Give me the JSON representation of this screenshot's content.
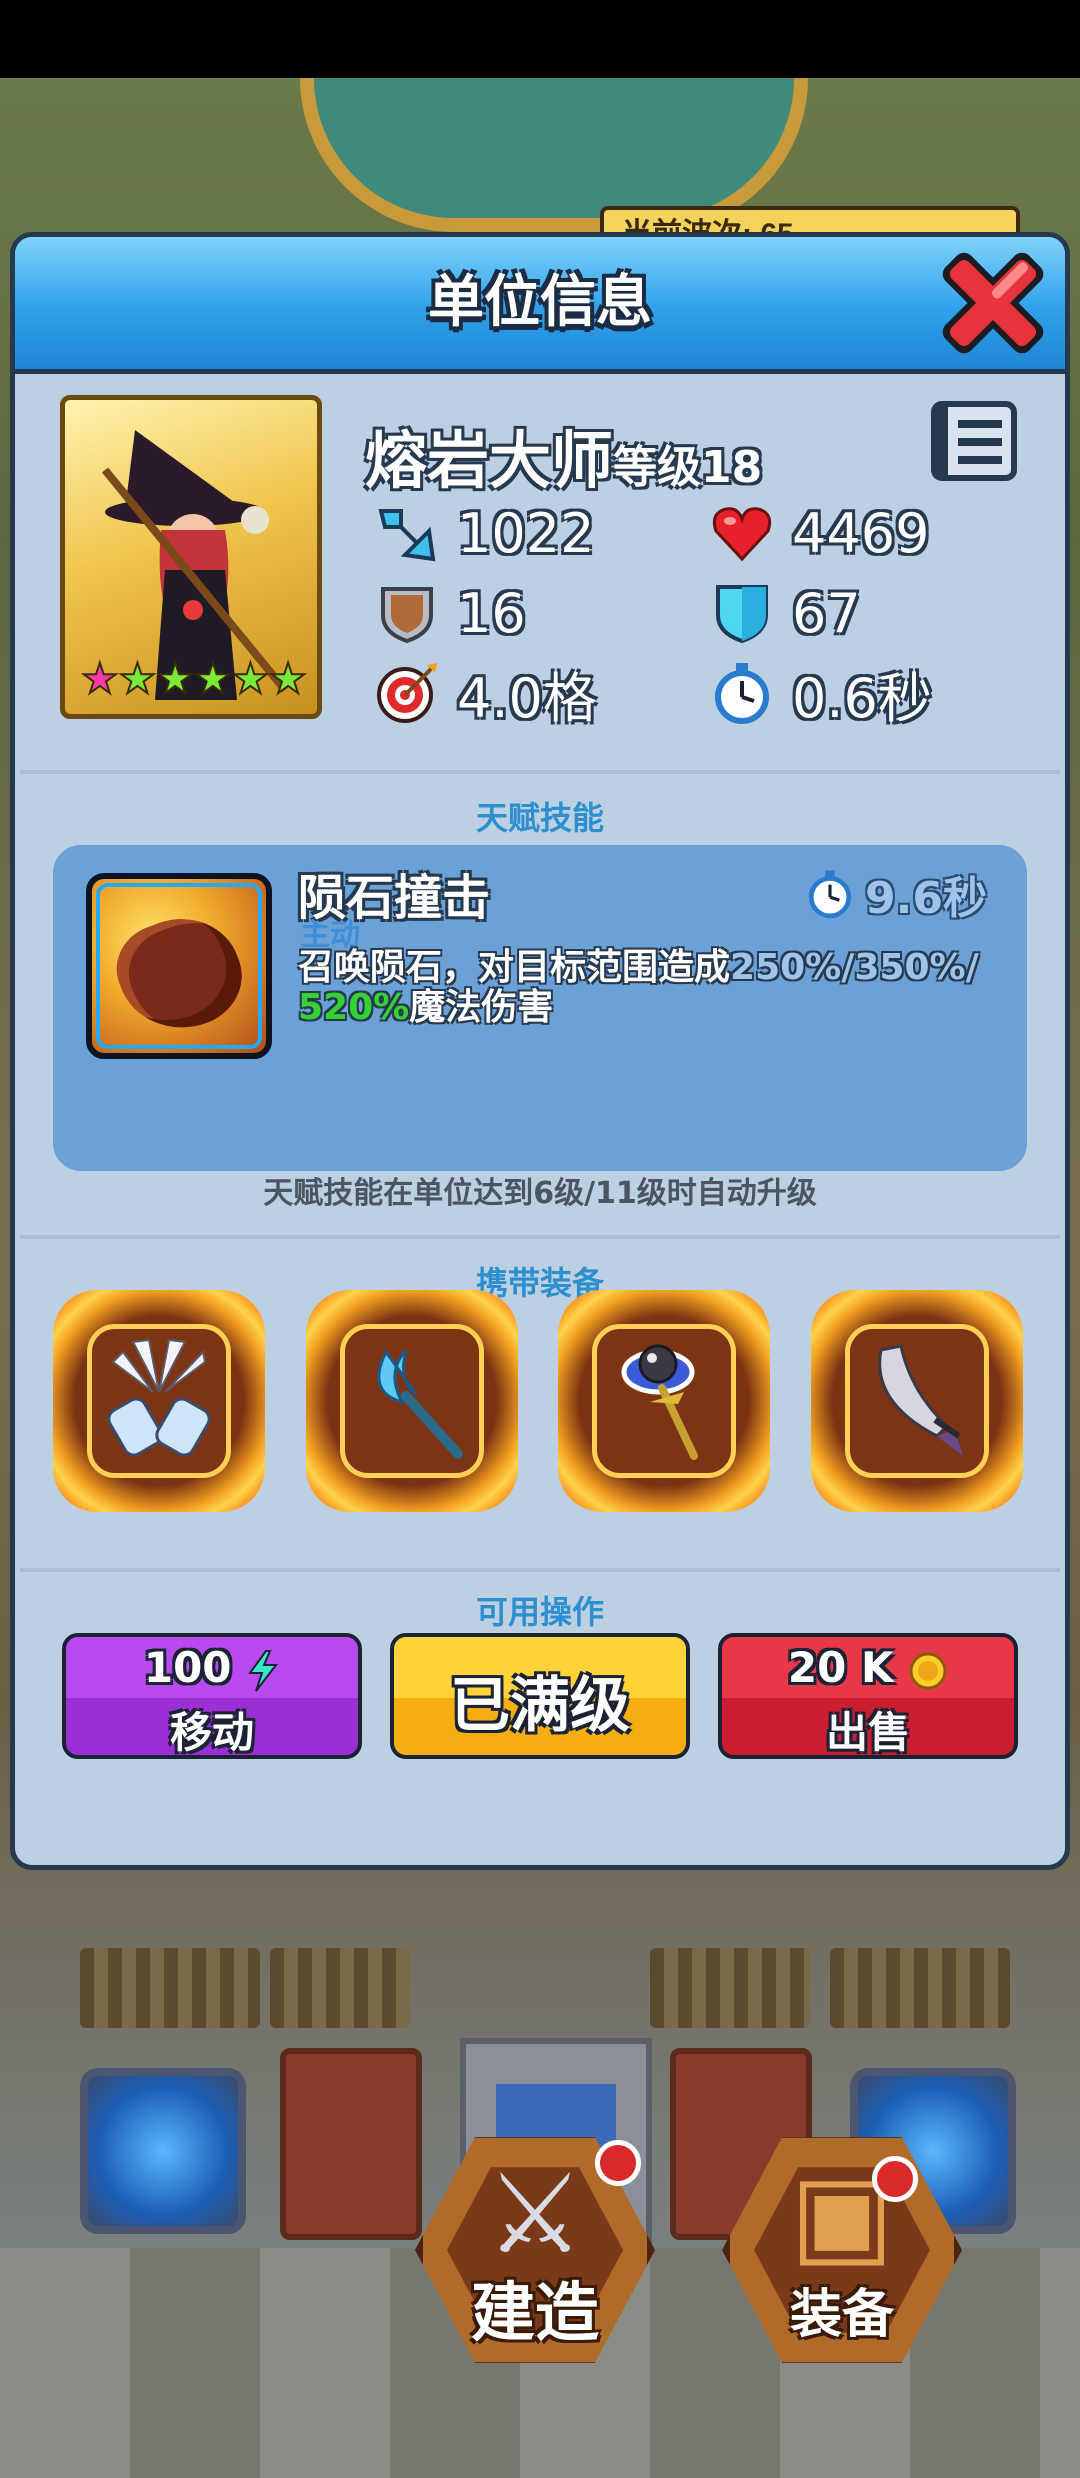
{
  "scene": {
    "wave_banner": "当前波次: 65"
  },
  "dialog": {
    "title": "单位信息",
    "unit": {
      "name": "熔岩大师",
      "level_label": "等级18",
      "stars": 6,
      "stats": {
        "attack": "1022",
        "hp": "4469",
        "armor": "16",
        "magic_resist": "67",
        "range": "4.0格",
        "attack_speed": "0.6秒"
      }
    },
    "talent_section_label": "天赋技能",
    "skill": {
      "name": "陨石撞击",
      "type": "主动",
      "cooldown": "9.6秒",
      "desc_main": "召唤陨石，对目标范围造成",
      "desc_dim": "250%/350%/",
      "desc_high": "520%",
      "desc_tail": "魔法伤害"
    },
    "skill_note": "天赋技能在单位达到6级/11级时自动升级",
    "equipment_section_label": "携带装备",
    "equipment": [
      {
        "icon": "winged-bracers-icon"
      },
      {
        "icon": "ice-staff-icon"
      },
      {
        "icon": "orb-scepter-icon"
      },
      {
        "icon": "curved-blade-icon"
      }
    ],
    "actions_section_label": "可用操作",
    "actions": {
      "move_cost": "100",
      "move_label": "移动",
      "max_level_label": "已满级",
      "sell_price": "20 K",
      "sell_label": "出售"
    }
  },
  "bottom_nav": {
    "build_label": "建造",
    "equip_label": "装备"
  },
  "colors": {
    "dialog_bg": "#bcd0e2",
    "header_blue": "#2fa1ea",
    "section_label": "#2c8fcf",
    "move_purple": "#9b2fd6",
    "max_yellow": "#f7be1e",
    "sell_red": "#d6283a",
    "highlight_green": "#35d235"
  }
}
